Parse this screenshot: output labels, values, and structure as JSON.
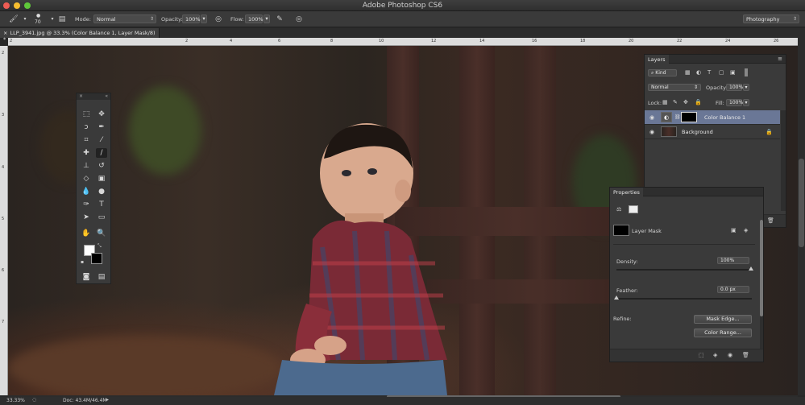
{
  "app": {
    "title": "Adobe Photoshop CS6"
  },
  "options": {
    "brush_size": "70",
    "mode_label": "Mode:",
    "mode_value": "Normal",
    "opacity_label": "Opacity:",
    "opacity_value": "100%",
    "flow_label": "Flow:",
    "flow_value": "100%",
    "workspace": "Photography"
  },
  "document": {
    "tab_title": "LLP_3941.jpg @ 33.3% (Color Balance 1, Layer Mask/8) *",
    "ruler_top": [
      "2",
      "2",
      "4",
      "6",
      "8",
      "10",
      "12",
      "14",
      "16",
      "18",
      "20",
      "22",
      "24",
      "26"
    ],
    "ruler_left": [
      "2",
      "3",
      "4",
      "5",
      "6",
      "7"
    ]
  },
  "status": {
    "zoom": "33.33%",
    "doc": "Doc: 43.4M/46.4M"
  },
  "layers_panel": {
    "title": "Layers",
    "filter_kind": "Kind",
    "blend_mode": "Normal",
    "opacity_label": "Opacity:",
    "opacity_value": "100%",
    "lock_label": "Lock:",
    "fill_label": "Fill:",
    "fill_value": "100%",
    "layers": [
      {
        "name": "Color Balance 1",
        "selected": true
      },
      {
        "name": "Background",
        "locked": true
      }
    ]
  },
  "properties_panel": {
    "title": "Properties",
    "mask_type": "Layer Mask",
    "density_label": "Density:",
    "density_value": "100%",
    "feather_label": "Feather:",
    "feather_value": "0.0 px",
    "refine_label": "Refine:",
    "mask_edge_button": "Mask Edge...",
    "color_range_button": "Color Range..."
  },
  "colors": {
    "accent_selected": "#6a7796",
    "panel": "#3a3a3a",
    "foreground": "#ffffff",
    "background": "#000000"
  }
}
